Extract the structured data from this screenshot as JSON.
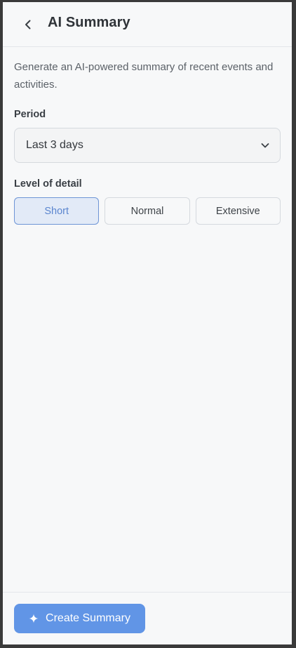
{
  "header": {
    "title": "AI Summary",
    "back_icon": "chevron-left-icon"
  },
  "description": "Generate an AI-powered summary of recent events and activities.",
  "period": {
    "label": "Period",
    "selected": "Last 3 days",
    "chevron_icon": "chevron-down-icon"
  },
  "detail": {
    "label": "Level of detail",
    "options": [
      "Short",
      "Normal",
      "Extensive"
    ],
    "selected": "Short"
  },
  "footer": {
    "create_label": "Create Summary",
    "create_icon": "sparkle-icon"
  },
  "colors": {
    "accent": "#6195e6",
    "active_segment_bg": "#e2eaf7",
    "active_segment_border": "#6e95d6",
    "background": "#f7f8f9"
  }
}
